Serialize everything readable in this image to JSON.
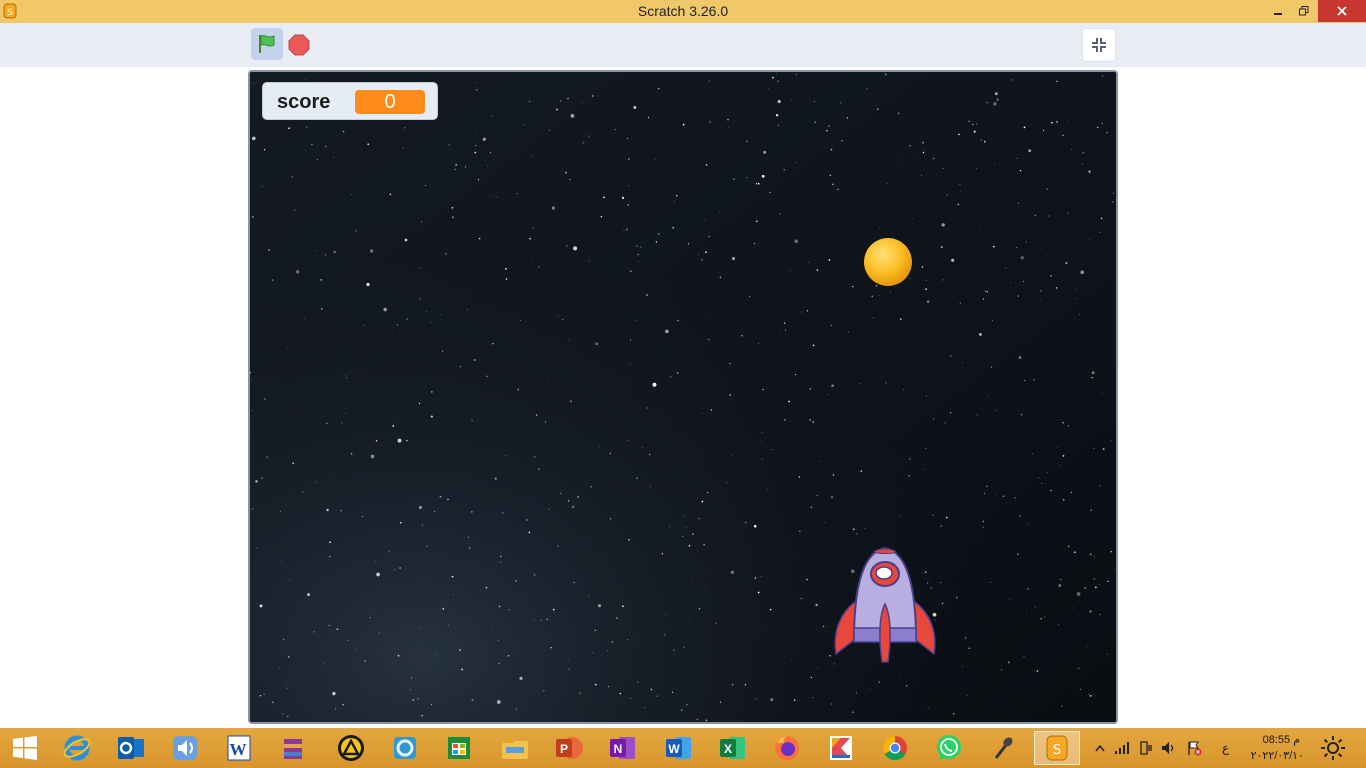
{
  "window": {
    "title": "Scratch 3.26.0",
    "controls": {
      "minimize": "minimize-icon",
      "restore": "restore-icon",
      "close": "close-icon"
    }
  },
  "toolbar": {
    "green_flag_icon": "green-flag-icon",
    "stop_icon": "stop-sign-icon",
    "fullscreen_icon": "unfullscreen-icon"
  },
  "stage": {
    "monitor": {
      "label": "score",
      "value": "0"
    },
    "backdrop": "stars-backdrop",
    "sprites": [
      "ball",
      "rocketship"
    ]
  },
  "taskbar": {
    "start_icon": "windows-start-icon",
    "apps": [
      "internet-explorer-icon",
      "outlook-icon",
      "audio-app-icon",
      "word-2003-icon",
      "winrar-icon",
      "archicad-icon",
      "app-circle-icon",
      "store-icon",
      "file-explorer-icon",
      "powerpoint-icon",
      "onenote-icon",
      "word-icon",
      "excel-icon",
      "firefox-icon",
      "kotlin-icon",
      "chrome-icon",
      "whatsapp-icon",
      "microphone-icon",
      "scratch-icon"
    ],
    "tray": {
      "language": "ع",
      "time": "08:55 م",
      "date": "٢٠٢٢/٠٣/١٠"
    }
  },
  "colors": {
    "titlebar": "#f0c86a",
    "close": "#c7372f",
    "toolbar": "#e8edf3",
    "monitor_value": "#ff8c1a",
    "taskbar": "#dea035"
  }
}
